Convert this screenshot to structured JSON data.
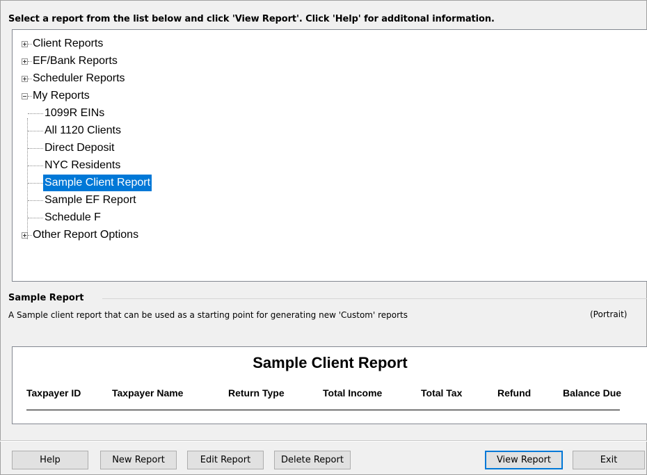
{
  "instruction": "Select a report from the list below and click 'View Report'. Click 'Help' for additonal information.",
  "tree": {
    "categories": [
      {
        "label": "Client Reports",
        "expanded": false
      },
      {
        "label": "EF/Bank Reports",
        "expanded": false
      },
      {
        "label": "Scheduler Reports",
        "expanded": false
      },
      {
        "label": "My Reports",
        "expanded": true
      },
      {
        "label": "Other Report Options",
        "expanded": false
      }
    ],
    "my_reports": [
      "1099R EINs",
      "All 1120 Clients",
      "Direct Deposit",
      "NYC Residents",
      "Sample Client Report",
      "Sample EF Report",
      "Schedule F"
    ],
    "selected": "Sample Client Report"
  },
  "details": {
    "title": "Sample Report",
    "description": "A Sample client report that can be used as a starting point for generating new 'Custom' reports",
    "orientation": "(Portrait)"
  },
  "preview": {
    "title": "Sample Client Report",
    "columns": [
      "Taxpayer ID",
      "Taxpayer Name",
      "Return Type",
      "Total Income",
      "Total Tax",
      "Refund",
      "Balance Due"
    ]
  },
  "buttons": {
    "help": "Help",
    "new_report": "New Report",
    "edit_report": "Edit Report",
    "delete_report": "Delete Report",
    "view_report": "View Report",
    "exit": "Exit"
  },
  "colors": {
    "selection": "#0078d7",
    "window_bg": "#f0f0f0"
  }
}
